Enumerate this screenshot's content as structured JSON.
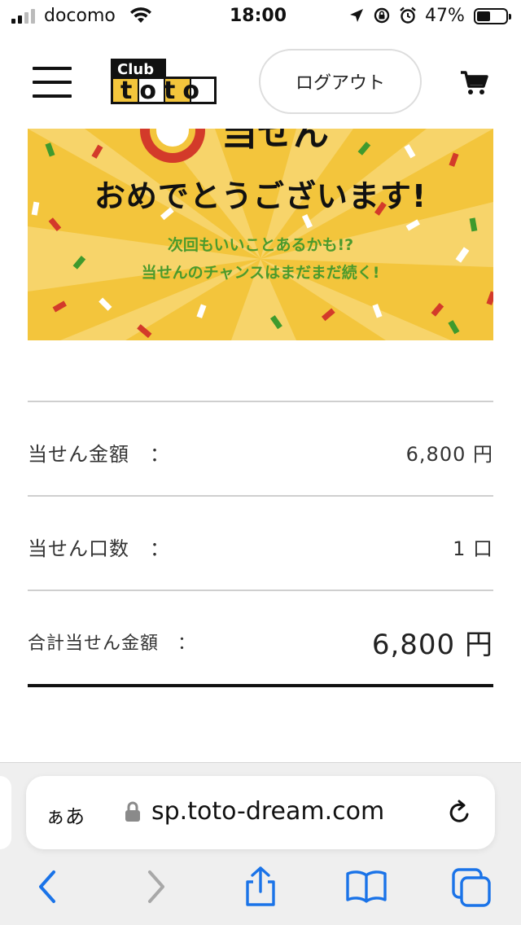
{
  "status": {
    "carrier": "docomo",
    "time": "18:00",
    "battery_percent": "47%",
    "battery_level": 0.47
  },
  "header": {
    "logo_text_top": "Club",
    "logo_text_main": "toto",
    "logout_label": "ログアウト"
  },
  "banner": {
    "title": "おめでとうございます!",
    "subtitle_line1": "次回もいいことあるかも!?",
    "subtitle_line2": "当せんのチャンスはまだまだ続く!"
  },
  "results": [
    {
      "label": "当せん金額　：",
      "value": "6,800 円"
    },
    {
      "label": "当せん口数　：",
      "value": "1 口"
    },
    {
      "label": "合計当せん金額　：",
      "value": "6,800 円"
    }
  ],
  "browser": {
    "text_size_label": "ぁあ",
    "url": "sp.toto-dream.com"
  },
  "colors": {
    "banner_bg": "#f3c53c",
    "banner_accent": "#4b9a2c",
    "ios_blue": "#1a73e8"
  },
  "icons": {
    "menu": "hamburger-icon",
    "cart": "cart-icon",
    "lock": "lock-icon",
    "reload": "reload-icon",
    "back": "chevron-left-icon",
    "forward": "chevron-right-icon",
    "share": "share-icon",
    "bookmarks": "book-icon",
    "tabs": "tabs-icon"
  }
}
